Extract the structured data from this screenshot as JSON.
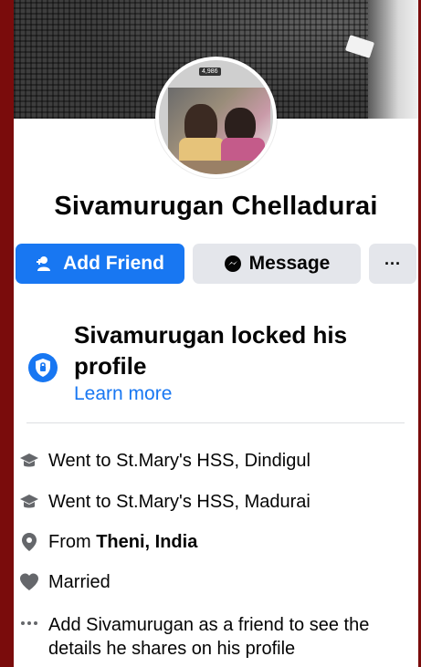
{
  "profile": {
    "name": "Sivamurugan Chelladurai",
    "avatar_tag": "4,986"
  },
  "actions": {
    "add_friend": "Add Friend",
    "message": "Message",
    "more": "···"
  },
  "locked": {
    "title": "Sivamurugan locked his profile",
    "learn_more": "Learn more"
  },
  "details": {
    "edu1": "Went to St.Mary's HSS, Dindigul",
    "edu2": "Went to St.Mary's HSS, Madurai",
    "from_prefix": "From ",
    "from_place": "Theni, India",
    "relationship": "Married",
    "note": "Add Sivamurugan as a friend to see the details he shares on his profile"
  },
  "colors": {
    "accent": "#1877f2",
    "button_gray": "#e4e6eb",
    "page_border": "#7a0c0c"
  },
  "icons": [
    "add-friend-icon",
    "messenger-icon",
    "more-icon",
    "shield-lock-icon",
    "graduation-cap-icon",
    "location-pin-icon",
    "heart-icon",
    "ellipsis-icon"
  ]
}
